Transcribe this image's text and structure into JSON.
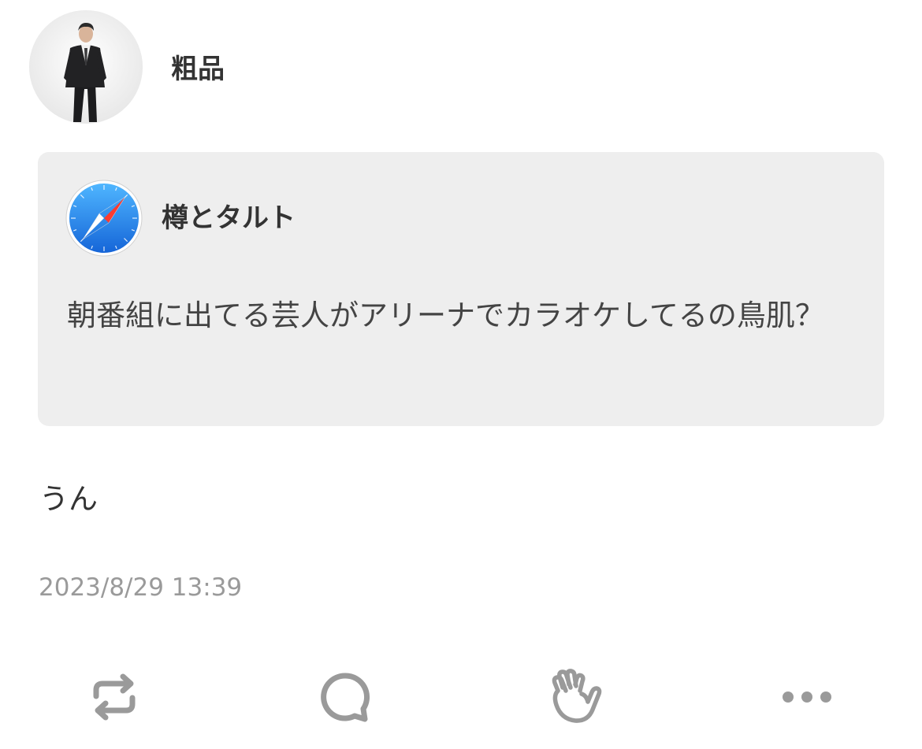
{
  "post": {
    "author": {
      "name": "粗品"
    },
    "quoted": {
      "author": {
        "name": "樽とタルト",
        "icon": "safari-compass-icon"
      },
      "text": "朝番組に出てる芸人がアリーナでカラオケしてるの鳥肌？"
    },
    "text": "うん",
    "timestamp": "2023/8/29 13:39"
  },
  "actions": {
    "repost_icon": "repost-icon",
    "reply_icon": "reply-icon",
    "clap_icon": "clap-icon",
    "more_icon": "more-icon"
  },
  "colors": {
    "quote_background": "#eeeeee",
    "icon_gray": "#9a9a9a",
    "text_dark": "#333333",
    "timestamp_gray": "#9a9a9a",
    "safari_blue": "#1e88e5",
    "safari_needle_red": "#ff3b30"
  }
}
